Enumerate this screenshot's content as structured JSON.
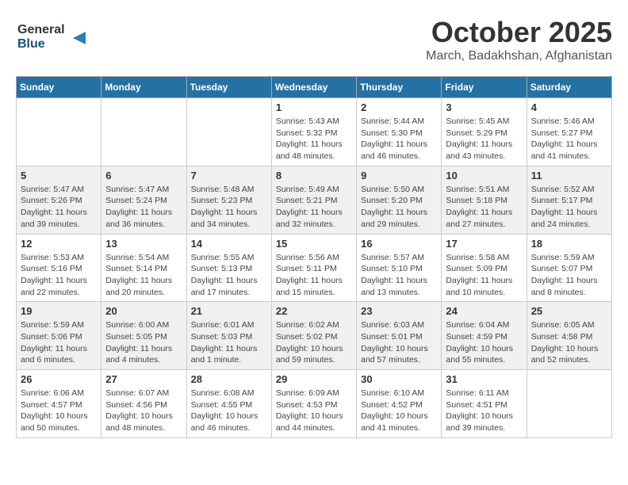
{
  "header": {
    "logo_general": "General",
    "logo_blue": "Blue",
    "month_title": "October 2025",
    "location": "March, Badakhshan, Afghanistan"
  },
  "days_of_week": [
    "Sunday",
    "Monday",
    "Tuesday",
    "Wednesday",
    "Thursday",
    "Friday",
    "Saturday"
  ],
  "weeks": [
    [
      {
        "day": "",
        "info": ""
      },
      {
        "day": "",
        "info": ""
      },
      {
        "day": "",
        "info": ""
      },
      {
        "day": "1",
        "info": "Sunrise: 5:43 AM\nSunset: 5:32 PM\nDaylight: 11 hours\nand 48 minutes."
      },
      {
        "day": "2",
        "info": "Sunrise: 5:44 AM\nSunset: 5:30 PM\nDaylight: 11 hours\nand 46 minutes."
      },
      {
        "day": "3",
        "info": "Sunrise: 5:45 AM\nSunset: 5:29 PM\nDaylight: 11 hours\nand 43 minutes."
      },
      {
        "day": "4",
        "info": "Sunrise: 5:46 AM\nSunset: 5:27 PM\nDaylight: 11 hours\nand 41 minutes."
      }
    ],
    [
      {
        "day": "5",
        "info": "Sunrise: 5:47 AM\nSunset: 5:26 PM\nDaylight: 11 hours\nand 39 minutes."
      },
      {
        "day": "6",
        "info": "Sunrise: 5:47 AM\nSunset: 5:24 PM\nDaylight: 11 hours\nand 36 minutes."
      },
      {
        "day": "7",
        "info": "Sunrise: 5:48 AM\nSunset: 5:23 PM\nDaylight: 11 hours\nand 34 minutes."
      },
      {
        "day": "8",
        "info": "Sunrise: 5:49 AM\nSunset: 5:21 PM\nDaylight: 11 hours\nand 32 minutes."
      },
      {
        "day": "9",
        "info": "Sunrise: 5:50 AM\nSunset: 5:20 PM\nDaylight: 11 hours\nand 29 minutes."
      },
      {
        "day": "10",
        "info": "Sunrise: 5:51 AM\nSunset: 5:18 PM\nDaylight: 11 hours\nand 27 minutes."
      },
      {
        "day": "11",
        "info": "Sunrise: 5:52 AM\nSunset: 5:17 PM\nDaylight: 11 hours\nand 24 minutes."
      }
    ],
    [
      {
        "day": "12",
        "info": "Sunrise: 5:53 AM\nSunset: 5:16 PM\nDaylight: 11 hours\nand 22 minutes."
      },
      {
        "day": "13",
        "info": "Sunrise: 5:54 AM\nSunset: 5:14 PM\nDaylight: 11 hours\nand 20 minutes."
      },
      {
        "day": "14",
        "info": "Sunrise: 5:55 AM\nSunset: 5:13 PM\nDaylight: 11 hours\nand 17 minutes."
      },
      {
        "day": "15",
        "info": "Sunrise: 5:56 AM\nSunset: 5:11 PM\nDaylight: 11 hours\nand 15 minutes."
      },
      {
        "day": "16",
        "info": "Sunrise: 5:57 AM\nSunset: 5:10 PM\nDaylight: 11 hours\nand 13 minutes."
      },
      {
        "day": "17",
        "info": "Sunrise: 5:58 AM\nSunset: 5:09 PM\nDaylight: 11 hours\nand 10 minutes."
      },
      {
        "day": "18",
        "info": "Sunrise: 5:59 AM\nSunset: 5:07 PM\nDaylight: 11 hours\nand 8 minutes."
      }
    ],
    [
      {
        "day": "19",
        "info": "Sunrise: 5:59 AM\nSunset: 5:06 PM\nDaylight: 11 hours\nand 6 minutes."
      },
      {
        "day": "20",
        "info": "Sunrise: 6:00 AM\nSunset: 5:05 PM\nDaylight: 11 hours\nand 4 minutes."
      },
      {
        "day": "21",
        "info": "Sunrise: 6:01 AM\nSunset: 5:03 PM\nDaylight: 11 hours\nand 1 minute."
      },
      {
        "day": "22",
        "info": "Sunrise: 6:02 AM\nSunset: 5:02 PM\nDaylight: 10 hours\nand 59 minutes."
      },
      {
        "day": "23",
        "info": "Sunrise: 6:03 AM\nSunset: 5:01 PM\nDaylight: 10 hours\nand 57 minutes."
      },
      {
        "day": "24",
        "info": "Sunrise: 6:04 AM\nSunset: 4:59 PM\nDaylight: 10 hours\nand 55 minutes."
      },
      {
        "day": "25",
        "info": "Sunrise: 6:05 AM\nSunset: 4:58 PM\nDaylight: 10 hours\nand 52 minutes."
      }
    ],
    [
      {
        "day": "26",
        "info": "Sunrise: 6:06 AM\nSunset: 4:57 PM\nDaylight: 10 hours\nand 50 minutes."
      },
      {
        "day": "27",
        "info": "Sunrise: 6:07 AM\nSunset: 4:56 PM\nDaylight: 10 hours\nand 48 minutes."
      },
      {
        "day": "28",
        "info": "Sunrise: 6:08 AM\nSunset: 4:55 PM\nDaylight: 10 hours\nand 46 minutes."
      },
      {
        "day": "29",
        "info": "Sunrise: 6:09 AM\nSunset: 4:53 PM\nDaylight: 10 hours\nand 44 minutes."
      },
      {
        "day": "30",
        "info": "Sunrise: 6:10 AM\nSunset: 4:52 PM\nDaylight: 10 hours\nand 41 minutes."
      },
      {
        "day": "31",
        "info": "Sunrise: 6:11 AM\nSunset: 4:51 PM\nDaylight: 10 hours\nand 39 minutes."
      },
      {
        "day": "",
        "info": ""
      }
    ]
  ]
}
